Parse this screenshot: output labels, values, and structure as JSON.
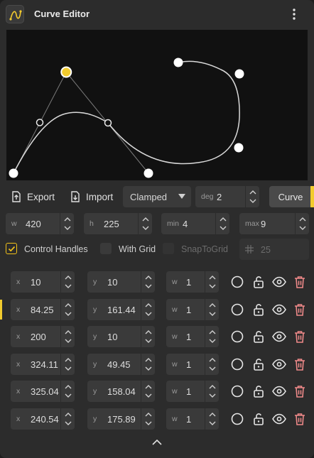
{
  "header": {
    "title": "Curve Editor",
    "app_icon": "curve-logo-icon",
    "menu_icon": "kebab-menu-icon"
  },
  "colors": {
    "accent": "#f2cb2e",
    "panel": "#2c2c2c",
    "canvas": "#111111",
    "field": "#3a3a3a",
    "danger": "#f08a8a"
  },
  "toolbar": {
    "export_label": "Export",
    "import_label": "Import",
    "interpolation": {
      "selected": "Clamped"
    },
    "degree": {
      "label": "deg",
      "value": "2"
    },
    "curve_button": "Curve"
  },
  "dimensions": {
    "width": {
      "label": "w",
      "value": "420"
    },
    "height": {
      "label": "h",
      "value": "225"
    },
    "min": {
      "label": "min",
      "value": "4"
    },
    "max": {
      "label": "max",
      "value": "9"
    }
  },
  "options": {
    "control_handles": {
      "label": "Control Handles",
      "checked": true
    },
    "with_grid": {
      "label": "With Grid",
      "checked": false
    },
    "snap_to_grid": {
      "label": "SnapToGrid",
      "checked": false,
      "disabled": true
    },
    "grid_size": {
      "value": "25"
    }
  },
  "points": [
    {
      "x": "10",
      "y": "10",
      "w": "1",
      "active": false
    },
    {
      "x": "84.25",
      "y": "161.44",
      "w": "1",
      "active": true
    },
    {
      "x": "200",
      "y": "10",
      "w": "1",
      "active": false
    },
    {
      "x": "324.11",
      "y": "49.45",
      "w": "1",
      "active": false
    },
    {
      "x": "325.04",
      "y": "158.04",
      "w": "1",
      "active": false
    },
    {
      "x": "240.54",
      "y": "175.89",
      "w": "1",
      "active": false
    }
  ],
  "point_field_labels": {
    "x": "x",
    "y": "y",
    "w": "w"
  },
  "row_icons": [
    "circle-icon",
    "unlock-icon",
    "eye-icon",
    "trash-icon"
  ]
}
